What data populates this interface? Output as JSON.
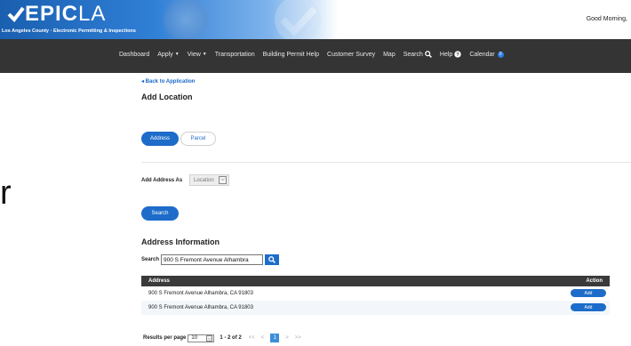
{
  "header": {
    "logo_main": "EPIC",
    "logo_light": "LA",
    "tagline": "Los Angeles County ◦ Electronic Permitting & Inspections",
    "greeting": "Good Morning,"
  },
  "nav": {
    "items": [
      {
        "label": "Dashboard"
      },
      {
        "label": "Apply",
        "caret": "▼"
      },
      {
        "label": "View",
        "caret": "▼"
      },
      {
        "label": "Transportation"
      },
      {
        "label": "Building Permit Help"
      },
      {
        "label": "Customer Survey"
      },
      {
        "label": "Map"
      },
      {
        "label": "Search"
      },
      {
        "label": "Help"
      },
      {
        "label": "Calendar",
        "badge": "0"
      }
    ]
  },
  "page": {
    "back_link": "◂ Back to Application",
    "title": "Add Location",
    "segments": {
      "address": "Address",
      "parcel": "Parcel"
    },
    "add_as_label": "Add Address As",
    "add_as_value": "Location",
    "search_button": "Search",
    "stray_char": "r"
  },
  "address_info": {
    "title": "Address Information",
    "search_label": "Search",
    "search_value": "900 S Fremont Avenue Alhambra",
    "columns": {
      "address": "Address",
      "action": "Action"
    },
    "rows": [
      {
        "address": "900 S Fremont Avenue Alhambra, CA 91803",
        "action": "Add"
      },
      {
        "address": "900 S Fremont Avenue Alhambra, CA 91803",
        "action": "Add"
      }
    ]
  },
  "pagination": {
    "label": "Results per page",
    "per_page": "10",
    "range": "1 - 2 of 2",
    "first": "<<",
    "prev": "<",
    "current": "1",
    "next": ">",
    "last": ">>"
  },
  "colors": {
    "primary": "#1d6cc9",
    "nav_bg": "#343434",
    "table_header": "#3a3a3a"
  }
}
